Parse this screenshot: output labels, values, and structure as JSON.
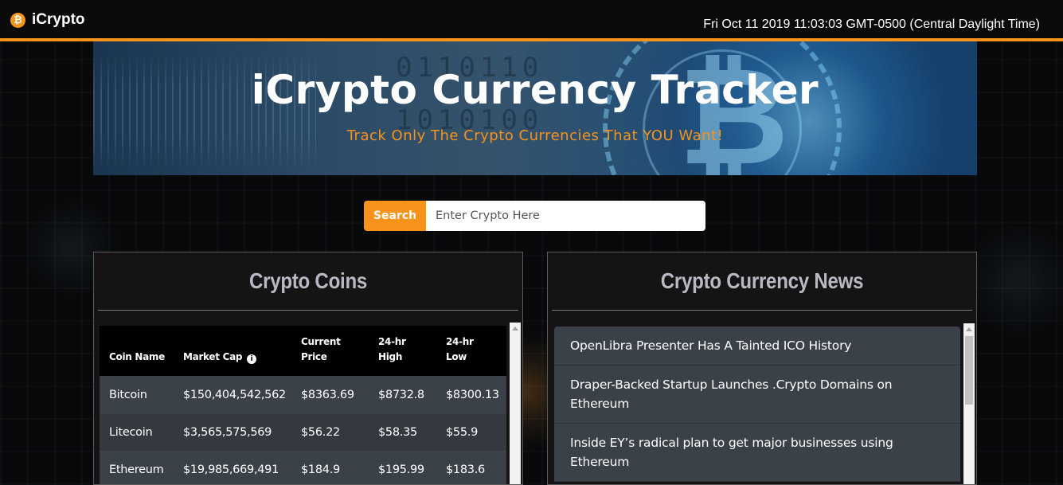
{
  "navbar": {
    "brand_icon": "bitcoin-icon",
    "brand": "iCrypto",
    "datetime": "Fri Oct 11 2019 11:03:03 GMT-0500 (Central Daylight Time)",
    "accent_color": "#f7931a"
  },
  "hero": {
    "title": "iCrypto Currency Tracker",
    "subtitle": "Track Only The Crypto Currencies That YOU Want!"
  },
  "search": {
    "button_label": "Search",
    "placeholder": "Enter Crypto Here",
    "value": ""
  },
  "coins_panel": {
    "title": "Crypto Coins",
    "columns": [
      "Coin Name",
      "Market Cap",
      "Current Price",
      "24-hr High",
      "24-hr Low"
    ],
    "market_cap_icon": "info-icon",
    "rows": [
      [
        "Bitcoin",
        "$150,404,542,562",
        "$8363.69",
        "$8732.8",
        "$8300.13"
      ],
      [
        "Litecoin",
        "$3,565,575,569",
        "$56.22",
        "$58.35",
        "$55.9"
      ],
      [
        "Ethereum",
        "$19,985,669,491",
        "$184.9",
        "$195.99",
        "$183.6"
      ]
    ]
  },
  "news_panel": {
    "title": "Crypto Currency News",
    "items": [
      "OpenLibra Presenter Has A Tainted ICO History",
      "Draper-Backed Startup Launches .Crypto Domains on Ethereum",
      "Inside EY’s radical plan to get major businesses using Ethereum"
    ]
  }
}
